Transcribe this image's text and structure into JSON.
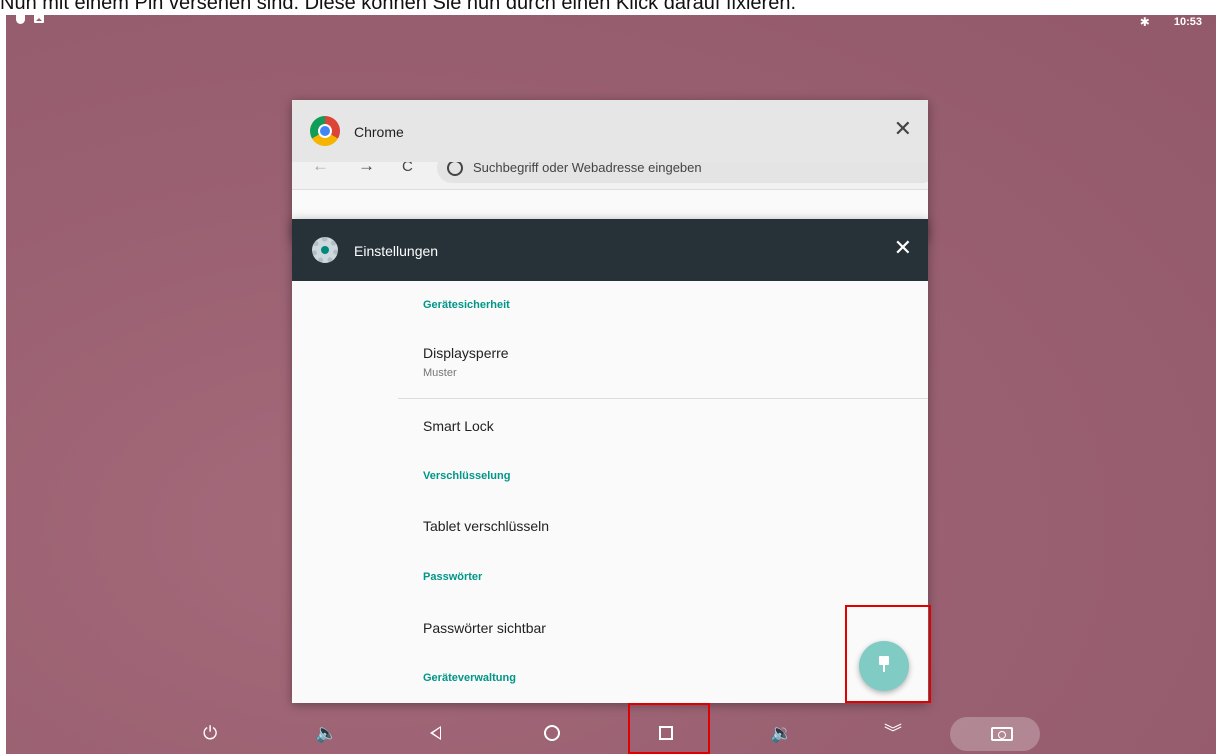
{
  "caption": "Nun mit einem Pin versehen sind. Diese können Sie nun durch einen Klick darauf fixieren.",
  "statusbar": {
    "time": "10:53",
    "icons": [
      "shield-icon",
      "image-icon",
      "bluetooth-icon"
    ]
  },
  "recents": {
    "chrome": {
      "title": "Chrome",
      "close": "✕",
      "omnibox_placeholder": "Suchbegriff oder Webadresse eingeben",
      "nav": {
        "back": "←",
        "forward": "→",
        "reload": "C"
      }
    },
    "settings": {
      "title": "Einstellungen",
      "close": "✕",
      "sections": [
        {
          "category": "Gerätesicherheit",
          "items": [
            {
              "label": "Displaysperre",
              "sub": "Muster"
            },
            {
              "label": "Smart Lock"
            }
          ]
        },
        {
          "category": "Verschlüsselung",
          "items": [
            {
              "label": "Tablet verschlüsseln"
            }
          ]
        },
        {
          "category": "Passwörter",
          "items": [
            {
              "label": "Passwörter sichtbar"
            }
          ]
        },
        {
          "category": "Geräteverwaltung",
          "items": []
        }
      ]
    }
  },
  "navbar": {
    "icons": [
      "power-icon",
      "volume-down-icon",
      "back-icon",
      "home-icon",
      "recents-icon",
      "volume-up-icon",
      "collapse-icon",
      "screenshot-icon"
    ],
    "power": "⏻",
    "vol_down": "🔈",
    "vol_up": "🔉",
    "collapse": "︾"
  },
  "colors": {
    "wallpaper": "#9a6172",
    "accent": "#009688",
    "fab": "#80cbc4",
    "settings_header": "#263238",
    "highlight": "#e00000"
  }
}
